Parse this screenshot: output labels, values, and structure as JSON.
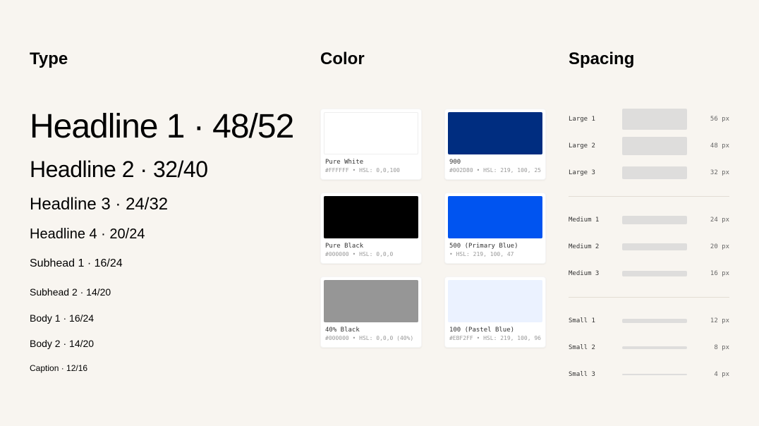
{
  "sections": {
    "type_title": "Type",
    "color_title": "Color",
    "spacing_title": "Spacing"
  },
  "type": {
    "h1": "Headline 1 · 48/52",
    "h2": "Headline 2 · 32/40",
    "h3": "Headline 3 · 24/32",
    "h4": "Headline 4 · 20/24",
    "sub1": "Subhead 1 · 16/24",
    "sub2": "Subhead 2 · 14/20",
    "body1": "Body 1 · 16/24",
    "body2": "Body 2 · 14/20",
    "caption": "Caption · 12/16"
  },
  "colors": {
    "c0": {
      "name": "Pure White",
      "meta": "#FFFFFF • HSL: 0,0,100",
      "hex": "#FFFFFF"
    },
    "c1": {
      "name": "Pure Black",
      "meta": "#000000 • HSL: 0,0,0",
      "hex": "#000000"
    },
    "c2": {
      "name": "40% Black",
      "meta": "#000000 • HSL: 0,0,0 (40%)",
      "hex": "#969696"
    },
    "c3": {
      "name": "900",
      "meta": "#002D80 • HSL: 219, 100, 25",
      "hex": "#002D80"
    },
    "c4": {
      "name": "500 (Primary Blue)",
      "meta": "• HSL: 219, 100, 47",
      "hex": "#0054F0"
    },
    "c5": {
      "name": "100 (Pastel Blue)",
      "meta": "#EBF2FF • HSL: 219, 100, 96",
      "hex": "#EBF2FF"
    }
  },
  "spacing": {
    "large": [
      {
        "label": "Large 1",
        "value": "56 px",
        "h": 30
      },
      {
        "label": "Large 2",
        "value": "48 px",
        "h": 26
      },
      {
        "label": "Large 3",
        "value": "32 px",
        "h": 18
      }
    ],
    "medium": [
      {
        "label": "Medium 1",
        "value": "24 px",
        "h": 12
      },
      {
        "label": "Medium 2",
        "value": "20 px",
        "h": 10
      },
      {
        "label": "Medium 3",
        "value": "16 px",
        "h": 8
      }
    ],
    "small": [
      {
        "label": "Small 1",
        "value": "12 px",
        "h": 6
      },
      {
        "label": "Small 2",
        "value": "8 px",
        "h": 4
      },
      {
        "label": "Small 3",
        "value": "4 px",
        "h": 2
      }
    ]
  }
}
